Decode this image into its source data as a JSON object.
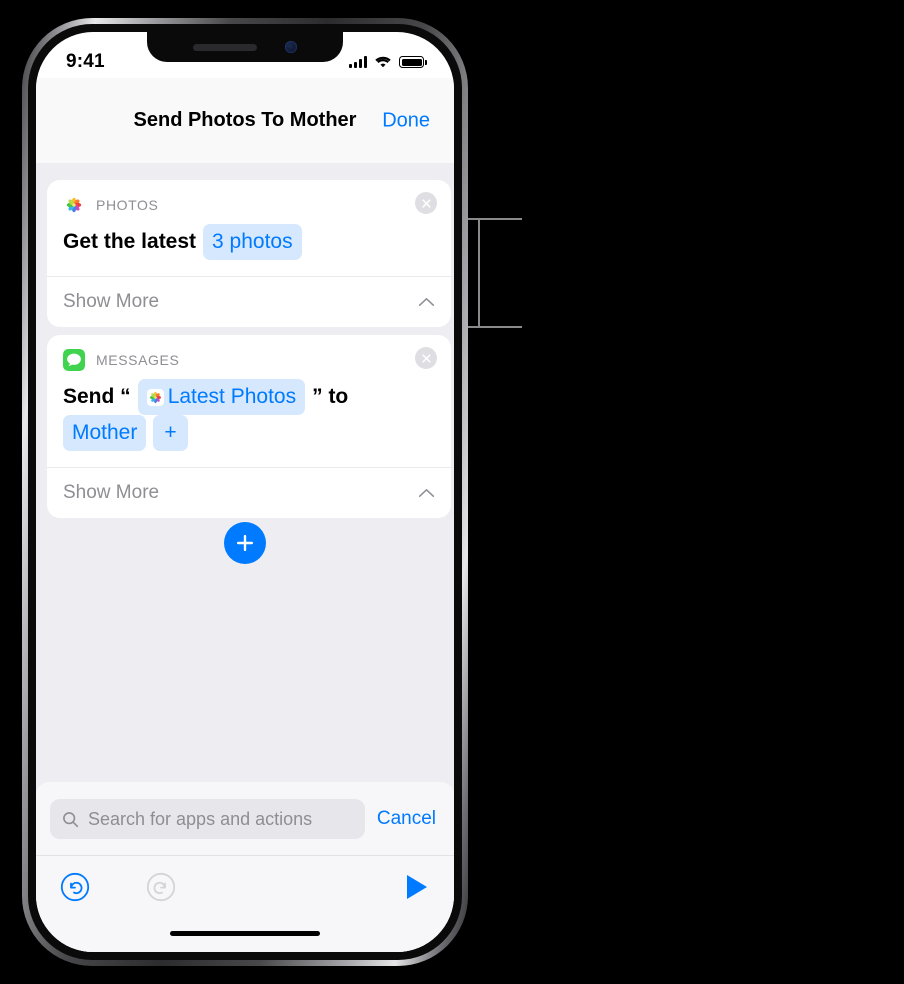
{
  "status_bar": {
    "time": "9:41",
    "icons": [
      "cellular-signal-icon",
      "wifi-icon",
      "battery-icon"
    ]
  },
  "nav_bar": {
    "title": "Send Photos To Mother",
    "done_label": "Done"
  },
  "actions": [
    {
      "app_name": "PHOTOS",
      "app_icon": "photos-app-icon",
      "close_label": "remove-action",
      "text_before": "Get the latest",
      "chips": [
        {
          "label": "3 photos",
          "icon": null
        }
      ],
      "show_more_label": "Show More"
    },
    {
      "app_name": "MESSAGES",
      "app_icon": "messages-app-icon",
      "close_label": "remove-action",
      "text_before": "Send “",
      "chip_inline": {
        "label": "Latest Photos",
        "icon": "photos-app-icon"
      },
      "text_middle": "” to",
      "chip_recipient": {
        "label": "Mother"
      },
      "chip_add": {
        "label": "+"
      },
      "show_more_label": "Show More"
    }
  ],
  "add_action_button": {
    "label": "+",
    "name": "add-action-button"
  },
  "search": {
    "placeholder": "Search for apps and actions",
    "value": "",
    "icon": "search-icon",
    "cancel_label": "Cancel"
  },
  "toolbar": {
    "undo": "undo-icon",
    "redo": "redo-icon",
    "run": "play-icon"
  },
  "colors": {
    "accent_blue": "#007aff",
    "chip_background": "#d6e8fd",
    "content_background": "#eeeef2",
    "card_background": "#ffffff",
    "muted_text": "#8e8e93",
    "messages_green": "#34c759"
  }
}
